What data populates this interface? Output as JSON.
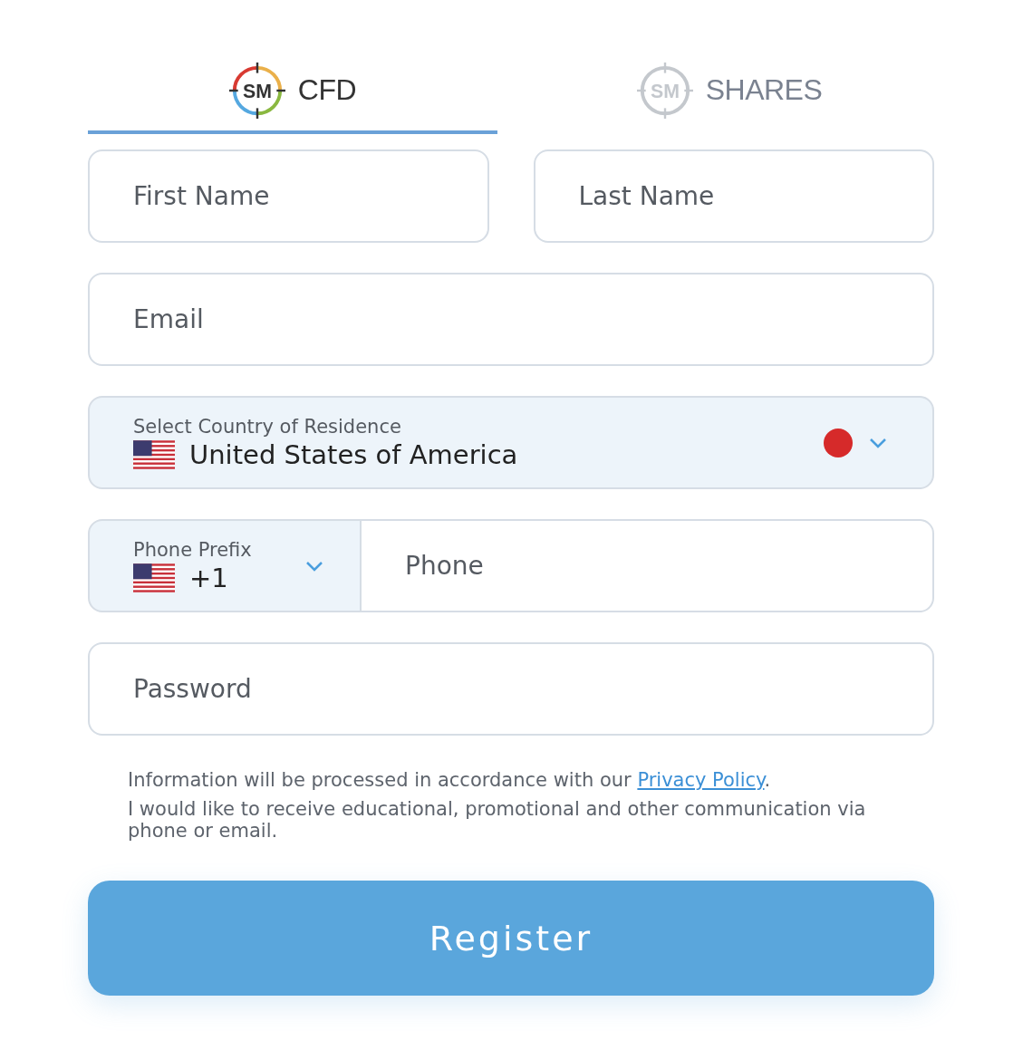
{
  "tabs": [
    {
      "logo": "SM",
      "label": "CFD",
      "selected": true
    },
    {
      "logo": "SM",
      "label": "SHARES",
      "selected": false
    }
  ],
  "fields": {
    "first_name": {
      "placeholder": "First Name"
    },
    "last_name": {
      "placeholder": "Last Name"
    },
    "email": {
      "placeholder": "Email"
    },
    "country": {
      "label": "Select Country of Residence",
      "value": "United States of America"
    },
    "phone_prefix": {
      "label": "Phone Prefix",
      "value": "+1"
    },
    "phone": {
      "placeholder": "Phone"
    },
    "password": {
      "placeholder": "Password"
    }
  },
  "notice": {
    "text": "Information will be processed in accordance with our ",
    "link": "Privacy Policy",
    "after": "."
  },
  "consent": "I would like to receive educational, promotional and other communication via phone or email.",
  "register_button": "Register"
}
